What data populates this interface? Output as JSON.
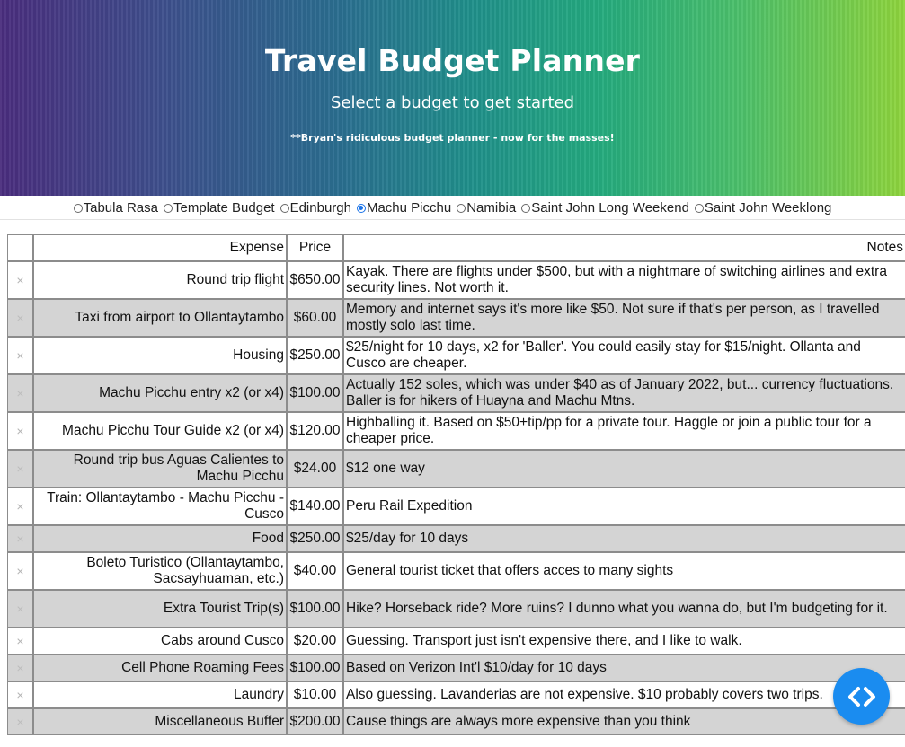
{
  "header": {
    "title": "Travel Budget Planner",
    "subtitle": "Select a budget to get started",
    "note": "**Bryan's ridiculous budget planner - now for the masses!"
  },
  "budgets": [
    {
      "label": "Tabula Rasa",
      "checked": false
    },
    {
      "label": "Template Budget",
      "checked": false
    },
    {
      "label": "Edinburgh",
      "checked": false
    },
    {
      "label": "Machu Picchu",
      "checked": true
    },
    {
      "label": "Namibia",
      "checked": false
    },
    {
      "label": "Saint John Long Weekend",
      "checked": false
    },
    {
      "label": "Saint John Weeklong",
      "checked": false
    }
  ],
  "table": {
    "headers": {
      "expense": "Expense",
      "price": "Price",
      "notes": "Notes"
    },
    "delete_glyph": "×",
    "rows": [
      {
        "expense": "Round trip flight",
        "price": "$650.00",
        "notes": "Kayak. There are flights under $500, but with a nightmare of switching airlines and extra security lines. Not worth it."
      },
      {
        "expense": "Taxi from airport to Ollantaytambo",
        "price": "$60.00",
        "notes": "Memory and internet says it's more like $50. Not sure if that's per person, as I travelled mostly solo last time."
      },
      {
        "expense": "Housing",
        "price": "$250.00",
        "notes": "$25/night for 10 days, x2 for 'Baller'. You could easily stay for $15/night. Ollanta and Cusco are cheaper."
      },
      {
        "expense": "Machu Picchu entry x2 (or x4)",
        "price": "$100.00",
        "notes": "Actually 152 soles, which was under $40 as of January 2022, but... currency fluctuations. Baller is for hikers of Huayna and Machu Mtns."
      },
      {
        "expense": "Machu Picchu Tour Guide x2 (or x4)",
        "price": "$120.00",
        "notes": "Highballing it. Based on $50+tip/pp for a private tour. Haggle or join a public tour for a cheaper price."
      },
      {
        "expense": "Round trip bus Aguas Calientes to Machu Picchu",
        "price": "$24.00",
        "notes": "$12 one way"
      },
      {
        "expense": "Train: Ollantaytambo - Machu Picchu - Cusco",
        "price": "$140.00",
        "notes": "Peru Rail Expedition"
      },
      {
        "expense": "Food",
        "price": "$250.00",
        "notes": "$25/day for 10 days",
        "short": true
      },
      {
        "expense": "Boleto Turistico (Ollantaytambo, Sacsayhuaman, etc.)",
        "price": "$40.00",
        "notes": "General tourist ticket that offers acces to many sights"
      },
      {
        "expense": "Extra Tourist Trip(s)",
        "price": "$100.00",
        "notes": "Hike? Horseback ride? More ruins? I dunno what you wanna do, but I'm budgeting for it."
      },
      {
        "expense": "Cabs around Cusco",
        "price": "$20.00",
        "notes": "Guessing. Transport just isn't expensive there, and I like to walk.",
        "short": true
      },
      {
        "expense": "Cell Phone Roaming Fees",
        "price": "$100.00",
        "notes": "Based on Verizon Int'l $10/day for 10 days",
        "short": true
      },
      {
        "expense": "Laundry",
        "price": "$10.00",
        "notes": "Also guessing. Lavanderias are not expensive. $10 probably covers two trips.",
        "short": true
      },
      {
        "expense": "Miscellaneous Buffer",
        "price": "$200.00",
        "notes": "Cause things are always more expensive than you think",
        "short": true
      }
    ]
  },
  "fab": {
    "icon": "code-brackets-icon",
    "color": "#1a8cf0"
  }
}
